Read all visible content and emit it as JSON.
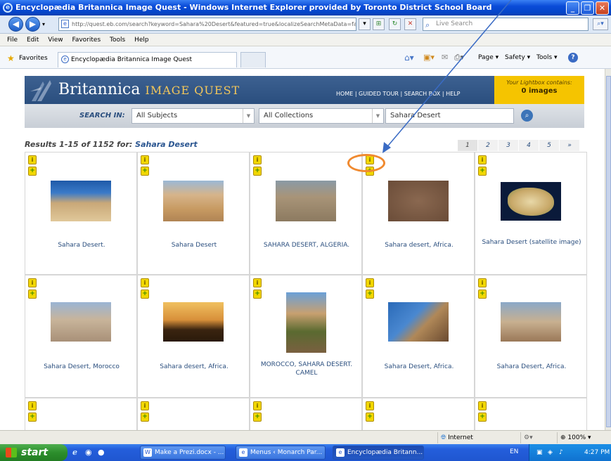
{
  "window": {
    "title": "Encyclopædia Britannica Image Quest - Windows Internet Explorer provided by Toronto District School Board"
  },
  "toolbar": {
    "address": "http://quest.eb.com/search?keyword=Sahara%20Desert&featured=true&localizeSearchMetaData=false",
    "address_domain": "eb.com",
    "search_placeholder": "Live Search"
  },
  "menus": [
    "File",
    "Edit",
    "View",
    "Favorites",
    "Tools",
    "Help"
  ],
  "favorites": {
    "label": "Favorites",
    "tab_title": "Encyclopædia Britannica Image Quest",
    "commands": [
      "Page ▾",
      "Safety ▾",
      "Tools ▾"
    ]
  },
  "site": {
    "brand": "Britannica",
    "brand_sub": "IMAGE QUEST",
    "nav": "HOME  |  GUIDED TOUR  |  SEARCH BOX  |  HELP",
    "lightbox_line1": "Your Lightbox contains:",
    "lightbox_line2": "0 images"
  },
  "search": {
    "label": "SEARCH IN:",
    "subjects": "All Subjects",
    "collections": "All Collections",
    "query": "Sahara Desert"
  },
  "results": {
    "prefix": "Results 1-15 of 1152 for: ",
    "query": "Sahara Desert"
  },
  "pager": [
    "1",
    "2",
    "3",
    "4",
    "5",
    "»"
  ],
  "grid": {
    "info_icon": "i",
    "add_icon": "+",
    "captions": [
      "Sahara Desert.",
      "Sahara Desert",
      "SAHARA DESERT, ALGERIA.",
      "Sahara desert, Africa.",
      "Sahara Desert (satellite image)",
      "Sahara Desert, Morocco",
      "Sahara desert, Africa.",
      "MOROCCO, SAHARA DESERT. CAMEL",
      "Sahara Desert, Africa.",
      "Sahara Desert, Africa."
    ]
  },
  "status": {
    "zone": "Internet",
    "zoom": "100%"
  },
  "taskbar": {
    "start": "start",
    "tasks": [
      "Make a Prezi.docx - ...",
      "Menus ‹ Monarch Par...",
      "Encyclopædia Britann..."
    ],
    "lang": "EN",
    "clock": "4:27 PM"
  },
  "colors": {
    "britannica_blue": "#2a4e7e",
    "lightbox_gold": "#f5c400",
    "annotation_orange": "#f08a30",
    "arrow_blue": "#3a6bc4"
  }
}
